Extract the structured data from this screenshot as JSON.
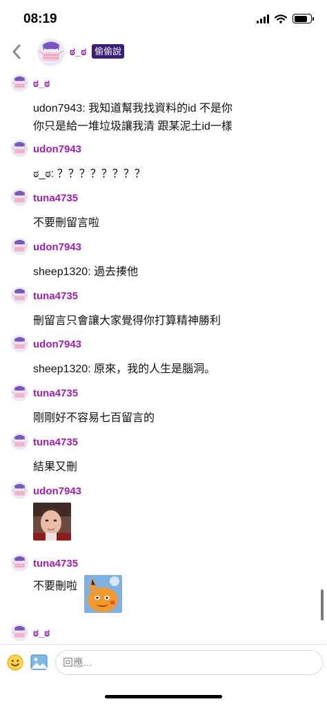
{
  "status_bar": {
    "time": "08:19"
  },
  "header": {
    "name": "ಠ_ಠ",
    "badge": "偷偷說"
  },
  "messages": [
    {
      "user": "ಠ_ಠ",
      "lines": [
        "udon7943: 我知道幫我找資料的id 不是你",
        "你只是給一堆垃圾讓我清 跟某泥土id一樣"
      ]
    },
    {
      "user": "udon7943",
      "lines": [
        "ಠ_ಠ: ？？？？？？？？"
      ]
    },
    {
      "user": "tuna4735",
      "lines": [
        "不要刪留言啦"
      ]
    },
    {
      "user": "udon7943",
      "lines": [
        "sheep1320: 過去揍他"
      ]
    },
    {
      "user": "tuna4735",
      "lines": [
        "刪留言只會讓大家覺得你打算精神勝利"
      ]
    },
    {
      "user": "udon7943",
      "lines": [
        "sheep1320: 原來，我的人生是腦洞。"
      ]
    },
    {
      "user": "tuna4735",
      "lines": [
        "剛剛好不容易七百留言的"
      ]
    },
    {
      "user": "tuna4735",
      "lines": [
        "結果又刪"
      ]
    },
    {
      "user": "udon7943",
      "lines": []
    },
    {
      "user": "tuna4735",
      "lines": [
        "不要刪啦"
      ]
    },
    {
      "user": "ಠ_ಠ",
      "lines": []
    }
  ],
  "composer": {
    "placeholder": "回應..."
  },
  "colors": {
    "username": "#a11cb8",
    "badge_bg": "#3a1e78",
    "avatar": "#7b55c2"
  },
  "icons": [
    "back-chevron-icon",
    "avatar-mask-icon",
    "emoji-icon",
    "image-icon",
    "signal-icon",
    "wifi-icon",
    "battery-icon"
  ]
}
